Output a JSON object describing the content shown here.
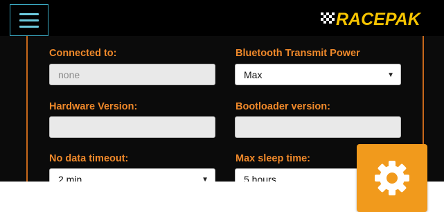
{
  "header": {
    "menu_icon": "hamburger-menu-icon",
    "brand": "RACEPAK",
    "brand_colors": {
      "text": "#f6c400",
      "flag": "#ffffff"
    }
  },
  "form": {
    "connected_to": {
      "label": "Connected to:",
      "placeholder": "none",
      "value": ""
    },
    "bt_power": {
      "label": "Bluetooth Transmit Power",
      "value": "Max"
    },
    "hardware_version": {
      "label": "Hardware Version:",
      "value": ""
    },
    "bootloader_version": {
      "label": "Bootloader version:",
      "value": ""
    },
    "no_data_timeout": {
      "label": "No data timeout:",
      "value": "2 min"
    },
    "max_sleep_time": {
      "label": "Max sleep time:",
      "value": "5 hours"
    }
  },
  "fab": {
    "icon": "gear-icon",
    "color": "#f19a1c"
  },
  "colors": {
    "label": "#f0892a",
    "panel_border": "#c8681a",
    "menu_accent": "#6cc9dd"
  }
}
